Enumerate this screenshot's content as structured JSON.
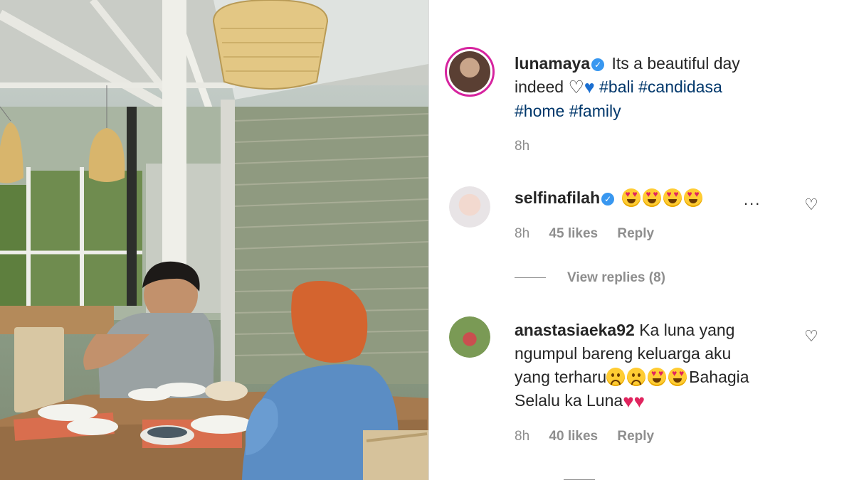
{
  "post": {
    "image_icon": "photo-family-dining",
    "caption": {
      "username": "lunamaya",
      "verified": true,
      "text_line1": "Its a beautiful day",
      "text_line2_prefix": "indeed",
      "hearts": [
        "white-heart-icon",
        "blue-heart-icon"
      ],
      "hashtags_line2": "#bali #candidasa",
      "hashtags_line3": "#home #family",
      "time": "8h"
    }
  },
  "comments": [
    {
      "username": "selfinafilah",
      "verified": true,
      "emojis": [
        "heart-eyes-emoji",
        "heart-eyes-emoji",
        "heart-eyes-emoji",
        "heart-eyes-emoji"
      ],
      "more": "...",
      "time": "8h",
      "likes": "45 likes",
      "reply": "Reply",
      "view_replies": "View replies (8)"
    },
    {
      "username": "anastasiaeka92",
      "line1": "Ka luna yang",
      "line2": "ngumpul bareng keluarga aku",
      "line3_prefix": "yang terharu",
      "line3_suffix": "Bahagia",
      "line4_prefix": "Selalu ka Luna",
      "time": "8h",
      "likes": "40 likes",
      "reply": "Reply"
    }
  ],
  "colors": {
    "verified": "#3897f0",
    "hashtag": "#00376b",
    "meta": "#8e8e8e",
    "story_ring": "#d6249f"
  }
}
